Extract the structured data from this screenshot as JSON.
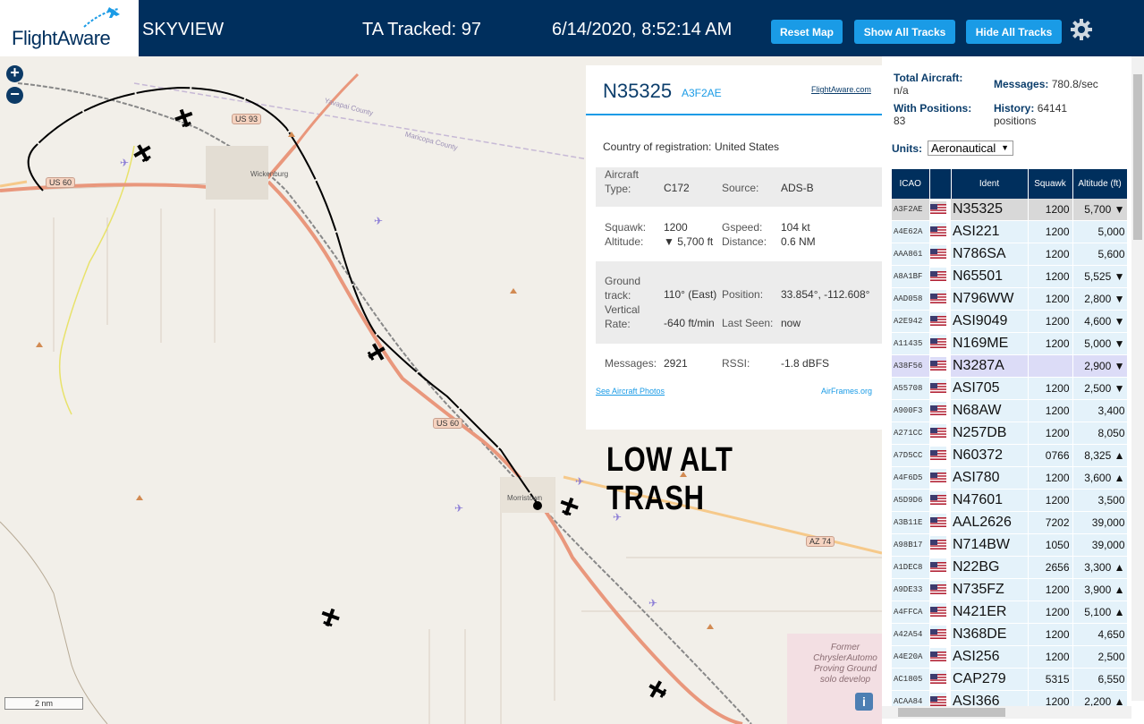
{
  "header": {
    "logo_text": "FlightAware",
    "app_name": "SKYVIEW",
    "tracked": "TA Tracked: 97",
    "datetime": "6/14/2020, 8:52:14 AM",
    "btn_reset": "Reset Map",
    "btn_show": "Show All Tracks",
    "btn_hide": "Hide All Tracks"
  },
  "map": {
    "zoom_in": "+",
    "zoom_out": "−",
    "scale": "2 nm",
    "overlay_text": "LOW ALT TRASH",
    "labels": {
      "wickenburg": "Wickenburg",
      "morristown": "Morristown",
      "yavapai": "Yavapai County",
      "maricopa": "Maricopa County",
      "us93": "US 93",
      "us60a": "US 60",
      "us60b": "US 60",
      "az74": "AZ 74",
      "proving": "Former ChryslerAutomo Proving Ground solo develop"
    },
    "info": "i"
  },
  "selected": {
    "ident": "N35325",
    "hex": "A3F2AE",
    "fa_link": "FlightAware.com",
    "country_label": "Country of registration:",
    "country": "United States",
    "aircraft_type_label": "Aircraft Type:",
    "aircraft_type": "C172",
    "source_label": "Source:",
    "source": "ADS-B",
    "squawk_label": "Squawk:",
    "squawk": "1200",
    "altitude_label": "Altitude:",
    "altitude": "▼ 5,700 ft",
    "gspeed_label": "Gspeed:",
    "gspeed": "104 kt",
    "distance_label": "Distance:",
    "distance": "0.6 NM",
    "track_label": "Ground track:",
    "track": "110° (East)",
    "position_label": "Position:",
    "position": "33.854°, -112.608°",
    "vrate_label": "Vertical Rate:",
    "vrate": "-640 ft/min",
    "lastseen_label": "Last Seen:",
    "lastseen": "now",
    "messages_label": "Messages:",
    "messages": "2921",
    "rssi_label": "RSSI:",
    "rssi": "-1.8 dBFS",
    "photos_link": "See Aircraft Photos",
    "airframes_link": "AirFrames.org"
  },
  "sidebar": {
    "total_label": "Total Aircraft:",
    "total_value": "n/a",
    "positions_label": "With Positions:",
    "positions_value": "83",
    "messages_label": "Messages:",
    "messages_value": "780.8/sec",
    "history_label": "History:",
    "history_value": "64141 positions",
    "units_label": "Units:",
    "units_value": "Aeronautical",
    "columns": [
      "ICAO",
      "",
      "Ident",
      "Squawk",
      "Altitude (ft)"
    ],
    "rows": [
      {
        "icao": "A3F2AE",
        "ident": "N35325",
        "squawk": "1200",
        "alt": "5,700 ▼"
      },
      {
        "icao": "A4E62A",
        "ident": "ASI221",
        "squawk": "1200",
        "alt": "5,000"
      },
      {
        "icao": "AAA861",
        "ident": "N786SA",
        "squawk": "1200",
        "alt": "5,600"
      },
      {
        "icao": "A8A1BF",
        "ident": "N65501",
        "squawk": "1200",
        "alt": "5,525 ▼"
      },
      {
        "icao": "AAD058",
        "ident": "N796WW",
        "squawk": "1200",
        "alt": "2,800 ▼"
      },
      {
        "icao": "A2E942",
        "ident": "ASI9049",
        "squawk": "1200",
        "alt": "4,600 ▼"
      },
      {
        "icao": "A11435",
        "ident": "N169ME",
        "squawk": "1200",
        "alt": "5,000 ▼"
      },
      {
        "icao": "A38F56",
        "ident": "N3287A",
        "squawk": "",
        "alt": "2,900 ▼"
      },
      {
        "icao": "A55708",
        "ident": "ASI705",
        "squawk": "1200",
        "alt": "2,500 ▼"
      },
      {
        "icao": "A900F3",
        "ident": "N68AW",
        "squawk": "1200",
        "alt": "3,400"
      },
      {
        "icao": "A271CC",
        "ident": "N257DB",
        "squawk": "1200",
        "alt": "8,050"
      },
      {
        "icao": "A7D5CC",
        "ident": "N60372",
        "squawk": "0766",
        "alt": "8,325 ▲"
      },
      {
        "icao": "A4F6D5",
        "ident": "ASI780",
        "squawk": "1200",
        "alt": "3,600 ▲"
      },
      {
        "icao": "A5D9D6",
        "ident": "N47601",
        "squawk": "1200",
        "alt": "3,500"
      },
      {
        "icao": "A3B11E",
        "ident": "AAL2626",
        "squawk": "7202",
        "alt": "39,000"
      },
      {
        "icao": "A98B17",
        "ident": "N714BW",
        "squawk": "1050",
        "alt": "39,000"
      },
      {
        "icao": "A1DEC8",
        "ident": "N22BG",
        "squawk": "2656",
        "alt": "3,300 ▲"
      },
      {
        "icao": "A9DE33",
        "ident": "N735FZ",
        "squawk": "1200",
        "alt": "3,900 ▲"
      },
      {
        "icao": "A4FFCA",
        "ident": "N421ER",
        "squawk": "1200",
        "alt": "5,100 ▲"
      },
      {
        "icao": "A42A54",
        "ident": "N368DE",
        "squawk": "1200",
        "alt": "4,650"
      },
      {
        "icao": "A4E20A",
        "ident": "ASI256",
        "squawk": "1200",
        "alt": "2,500"
      },
      {
        "icao": "AC1805",
        "ident": "CAP279",
        "squawk": "5315",
        "alt": "6,550"
      },
      {
        "icao": "ACAA84",
        "ident": "ASI366",
        "squawk": "1200",
        "alt": "2,200 ▲"
      }
    ]
  },
  "colors": {
    "header_bg": "#002f5d",
    "button": "#1a9be6",
    "row_bg": "#e4f2fa",
    "selected_row": "#d8d8d8"
  }
}
